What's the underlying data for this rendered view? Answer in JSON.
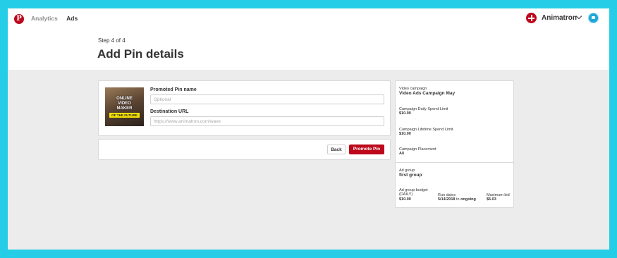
{
  "nav": {
    "logo": "P",
    "items": [
      {
        "label": "Analytics",
        "active": false
      },
      {
        "label": "Ads",
        "active": true
      }
    ]
  },
  "user": {
    "name": "Animatron"
  },
  "header": {
    "step": "Step 4 of 4",
    "title": "Add Pin details"
  },
  "pin": {
    "thumb_lines": [
      "ONLINE",
      "VIDEO",
      "MAKER"
    ],
    "thumb_band": "OF THE FUTURE",
    "name_label": "Promoted Pin name",
    "name_placeholder": "Optional",
    "url_label": "Destination URL",
    "url_placeholder": "https://www.animatron.com/wave"
  },
  "actions": {
    "back": "Back",
    "promote": "Promote Pin"
  },
  "summary": {
    "campaign_label": "Video campaign",
    "campaign_value": "Video Ads Campaign May",
    "daily_label": "Campaign Daily Spend Limit",
    "daily_value": "$10.00",
    "lifetime_label": "Campaign Lifetime Spend Limit",
    "lifetime_value": "$10.00",
    "placement_label": "Campaign Placement",
    "placement_value": "All",
    "adgroup_label": "Ad group",
    "adgroup_value": "first group",
    "budget_label_1": "Ad group budget",
    "budget_label_2": "(DAILY)",
    "budget_value": "$10.00",
    "run_label": "Run dates",
    "run_start": "5/14/2018",
    "run_to": "to",
    "run_end": "ongoing",
    "bid_label": "Maximum bid",
    "bid_value": "$6.03"
  },
  "colors": {
    "accent": "#bd081c",
    "background": "#25cde6",
    "panel": "#ececec"
  }
}
